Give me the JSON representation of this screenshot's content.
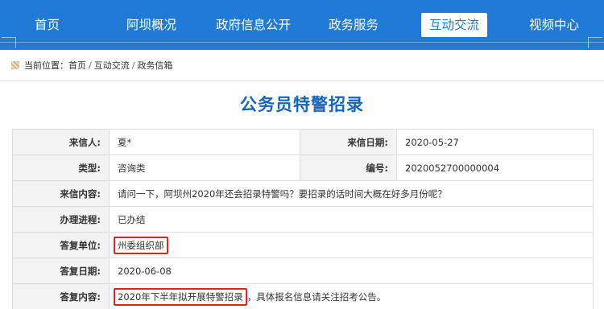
{
  "nav": {
    "items": [
      {
        "label": "首页"
      },
      {
        "label": "阿坝概况"
      },
      {
        "label": "政府信息公开"
      },
      {
        "label": "政务服务"
      },
      {
        "label": "互动交流",
        "active": true
      },
      {
        "label": "视频中心"
      }
    ],
    "bg_color": "#1f7bd6"
  },
  "breadcrumb": {
    "prefix": "当前位置：",
    "items": [
      "首页",
      "互动交流",
      "政务信箱"
    ],
    "separator": "/"
  },
  "page_title": "公务员特警招录",
  "letter": {
    "sender_label": "来信人:",
    "sender_value": "夏*",
    "date_label": "来信日期:",
    "date_value": "2020-05-27",
    "type_label": "类型:",
    "type_value": "咨询类",
    "number_label": "编号:",
    "number_value": "2020052700000004",
    "content_label": "来信内容:",
    "content_value": "请问一下，阿坝州2020年还会招录特警吗？要招录的话时间大概在好多月份呢？",
    "progress_label": "办理进程:",
    "progress_value": "已办结",
    "reply_unit_label": "答复单位:",
    "reply_unit_value": "州委组织部",
    "reply_date_label": "答复日期:",
    "reply_date_value": "2020-06-08",
    "reply_content_label": "答复内容:",
    "reply_content_highlight": "2020年下半年拟开展特警招录",
    "reply_content_rest": "，具体报名信息请关注招考公告。"
  },
  "colors": {
    "accent": "#1366bf",
    "highlight_box": "#e0261b",
    "label_bg": "#f3f3f3"
  }
}
